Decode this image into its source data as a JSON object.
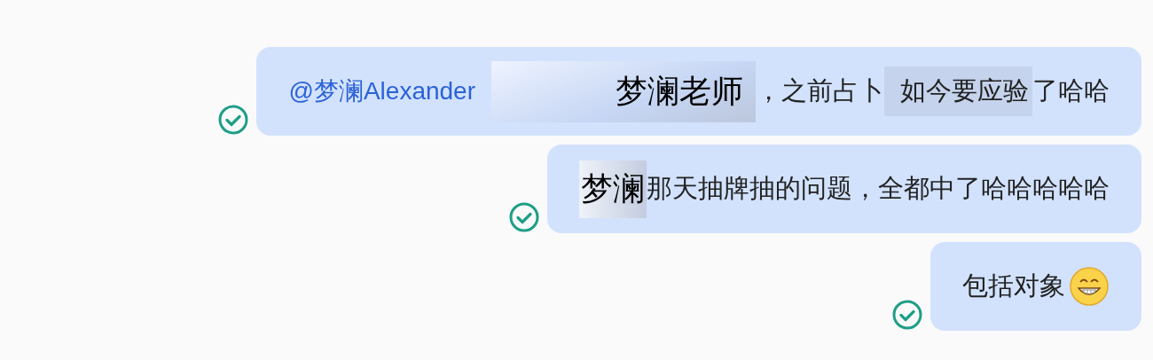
{
  "messages": [
    {
      "read": true,
      "segments": [
        {
          "kind": "mention",
          "text": "@梦澜Alexander"
        },
        {
          "kind": "name-card",
          "text": "梦澜老师"
        },
        {
          "kind": "text",
          "text": "，之前占卜"
        },
        {
          "kind": "boxed",
          "text": "如今要应验"
        },
        {
          "kind": "text",
          "text": "了哈哈"
        }
      ]
    },
    {
      "read": true,
      "segments": [
        {
          "kind": "highlight",
          "text": "梦澜"
        },
        {
          "kind": "text",
          "text": "那天抽牌抽的问题，全都中了哈哈哈哈哈"
        }
      ]
    },
    {
      "read": true,
      "segments": [
        {
          "kind": "text",
          "text": "包括对象"
        },
        {
          "kind": "emoji"
        }
      ]
    }
  ]
}
